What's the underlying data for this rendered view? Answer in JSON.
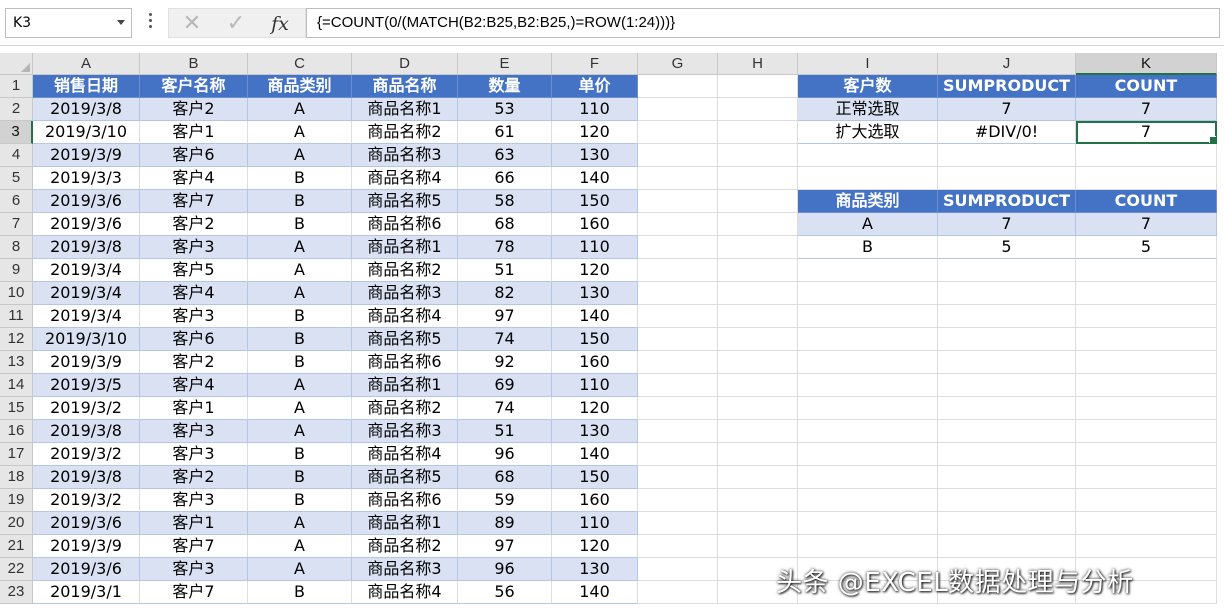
{
  "formula_bar": {
    "name_box": "K3",
    "formula": "{=COUNT(0/(MATCH(B2:B25,B2:B25,)=ROW(1:24)))}",
    "fx_label": "fx",
    "cancel_icon": "cancel-icon",
    "enter_icon": "check-icon"
  },
  "columns": [
    "A",
    "B",
    "C",
    "D",
    "E",
    "F",
    "G",
    "H",
    "I",
    "J",
    "K"
  ],
  "active_column": "K",
  "active_row": "3",
  "rows": [
    "1",
    "2",
    "3",
    "4",
    "5",
    "6",
    "7",
    "8",
    "9",
    "10",
    "11",
    "12",
    "13",
    "14",
    "15",
    "16",
    "17",
    "18",
    "19",
    "20",
    "21",
    "22",
    "23"
  ],
  "sales_table": {
    "headers": [
      "销售日期",
      "客户名称",
      "商品类别",
      "商品名称",
      "数量",
      "单价"
    ],
    "rows": [
      [
        "2019/3/8",
        "客户2",
        "A",
        "商品名称1",
        "53",
        "110"
      ],
      [
        "2019/3/10",
        "客户1",
        "A",
        "商品名称2",
        "61",
        "120"
      ],
      [
        "2019/3/9",
        "客户6",
        "A",
        "商品名称3",
        "63",
        "130"
      ],
      [
        "2019/3/3",
        "客户4",
        "B",
        "商品名称4",
        "66",
        "140"
      ],
      [
        "2019/3/6",
        "客户7",
        "B",
        "商品名称5",
        "58",
        "150"
      ],
      [
        "2019/3/6",
        "客户2",
        "B",
        "商品名称6",
        "68",
        "160"
      ],
      [
        "2019/3/8",
        "客户3",
        "A",
        "商品名称1",
        "78",
        "110"
      ],
      [
        "2019/3/4",
        "客户5",
        "A",
        "商品名称2",
        "51",
        "120"
      ],
      [
        "2019/3/4",
        "客户4",
        "A",
        "商品名称3",
        "82",
        "130"
      ],
      [
        "2019/3/4",
        "客户3",
        "B",
        "商品名称4",
        "97",
        "140"
      ],
      [
        "2019/3/10",
        "客户6",
        "B",
        "商品名称5",
        "74",
        "150"
      ],
      [
        "2019/3/9",
        "客户2",
        "B",
        "商品名称6",
        "92",
        "160"
      ],
      [
        "2019/3/5",
        "客户4",
        "A",
        "商品名称1",
        "69",
        "110"
      ],
      [
        "2019/3/2",
        "客户1",
        "A",
        "商品名称2",
        "74",
        "120"
      ],
      [
        "2019/3/8",
        "客户3",
        "A",
        "商品名称3",
        "51",
        "130"
      ],
      [
        "2019/3/2",
        "客户3",
        "B",
        "商品名称4",
        "96",
        "140"
      ],
      [
        "2019/3/8",
        "客户2",
        "B",
        "商品名称5",
        "68",
        "150"
      ],
      [
        "2019/3/2",
        "客户3",
        "B",
        "商品名称6",
        "59",
        "160"
      ],
      [
        "2019/3/6",
        "客户1",
        "A",
        "商品名称1",
        "89",
        "110"
      ],
      [
        "2019/3/9",
        "客户7",
        "A",
        "商品名称2",
        "97",
        "120"
      ],
      [
        "2019/3/6",
        "客户3",
        "A",
        "商品名称3",
        "96",
        "130"
      ],
      [
        "2019/3/1",
        "客户7",
        "B",
        "商品名称4",
        "56",
        "140"
      ]
    ]
  },
  "customer_count_table": {
    "headers": [
      "客户数",
      "SUMPRODUCT",
      "COUNT"
    ],
    "rows": [
      [
        "正常选取",
        "7",
        "7"
      ],
      [
        "扩大选取",
        "#DIV/0!",
        "7"
      ]
    ]
  },
  "category_table": {
    "headers": [
      "商品类别",
      "SUMPRODUCT",
      "COUNT"
    ],
    "rows": [
      [
        "A",
        "7",
        "7"
      ],
      [
        "B",
        "5",
        "5"
      ]
    ]
  },
  "watermark": "头条 @EXCEL数据处理与分析",
  "colors": {
    "header_fill": "#4472c4",
    "band_fill": "#d9e1f2",
    "selection": "#217346"
  }
}
